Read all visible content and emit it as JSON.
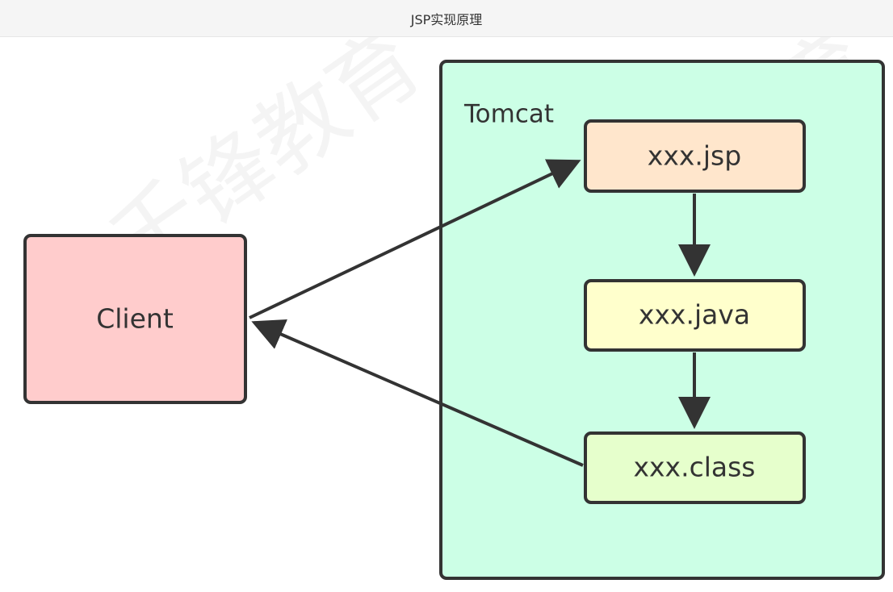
{
  "window": {
    "title": "JSP实现原理"
  },
  "diagram": {
    "container_label": "Tomcat",
    "client_label": "Client",
    "nodes": {
      "jsp": "xxx.jsp",
      "java": "xxx.java",
      "class": "xxx.class"
    },
    "colors": {
      "client_fill": "#ffcccc",
      "container_fill": "#ccffe6",
      "jsp_fill": "#ffe6cc",
      "java_fill": "#ffffcc",
      "class_fill": "#e6ffcc",
      "stroke": "#333333"
    },
    "watermark_text": "千锋教育"
  }
}
